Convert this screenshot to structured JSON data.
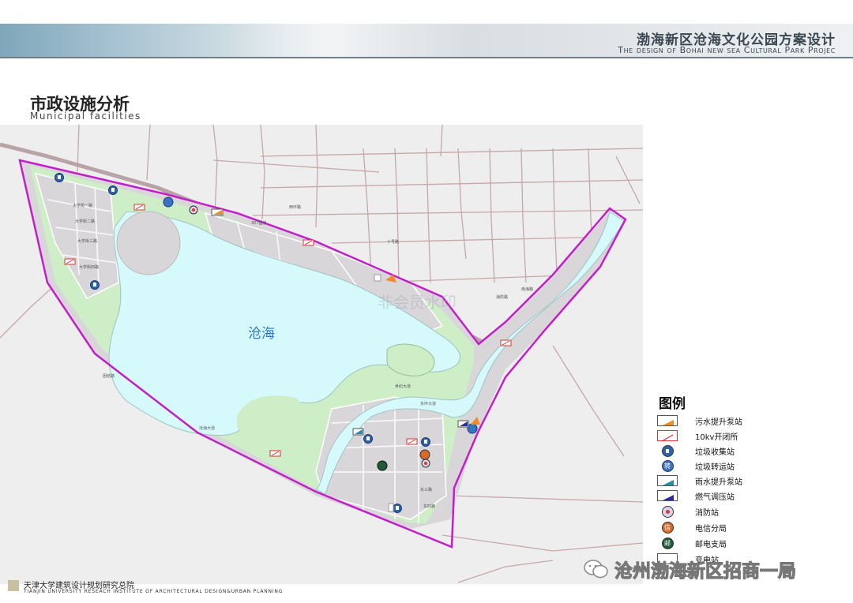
{
  "header": {
    "project_title": "渤海新区沧海文化公园方案设计",
    "project_subtitle": "The design of Bohai new sea Cultural Park Projec"
  },
  "section": {
    "title_cn": "市政设施分析",
    "title_en": "Municipal facilities"
  },
  "map": {
    "lake_label": "沧海",
    "faint_watermark": "非会员水印",
    "colors": {
      "lake": "#d6f9fb",
      "green": "#cdeec6",
      "urban": "#d9d6da",
      "boundary": "#c21fc8",
      "road": "#b79a9e",
      "facility_blue": "#2e63b0"
    },
    "road_labels": [
      "大学街一路",
      "大学街二路",
      "大学街三路",
      "大学街四路",
      "307国道",
      "沧海大道",
      "十号路",
      "海防路",
      "南海路",
      "世纪大道",
      "东环大道",
      "东三路",
      "东四路",
      "西环路",
      "团结路"
    ]
  },
  "legend": {
    "title": "图例",
    "items": [
      {
        "label": "污水提升泵站",
        "symbol": "sewage-pump"
      },
      {
        "label": "10kv开闭所",
        "symbol": "switch-station"
      },
      {
        "label": "垃圾收集站",
        "symbol": "garbage-collection"
      },
      {
        "label": "垃圾转运站",
        "symbol": "garbage-transfer",
        "glyph": "转"
      },
      {
        "label": "雨水提升泵站",
        "symbol": "rain-pump"
      },
      {
        "label": "燃气调压站",
        "symbol": "gas-regulator"
      },
      {
        "label": "消防站",
        "symbol": "fire-station"
      },
      {
        "label": "电信分局",
        "symbol": "telecom",
        "glyph": "信"
      },
      {
        "label": "邮电支局",
        "symbol": "post-office",
        "glyph": "邮"
      },
      {
        "label": "变电站",
        "symbol": "substation"
      }
    ]
  },
  "footer": {
    "institute_cn": "天津大学建筑设计规划研究总院",
    "institute_en": "TIANJIN UNIVERSITY RESEACH INSTITUTE OF ARCHITECTURAL DESIGN&URBAN PLANNING"
  },
  "watermark": {
    "text": "沧州渤海新区招商一局"
  }
}
